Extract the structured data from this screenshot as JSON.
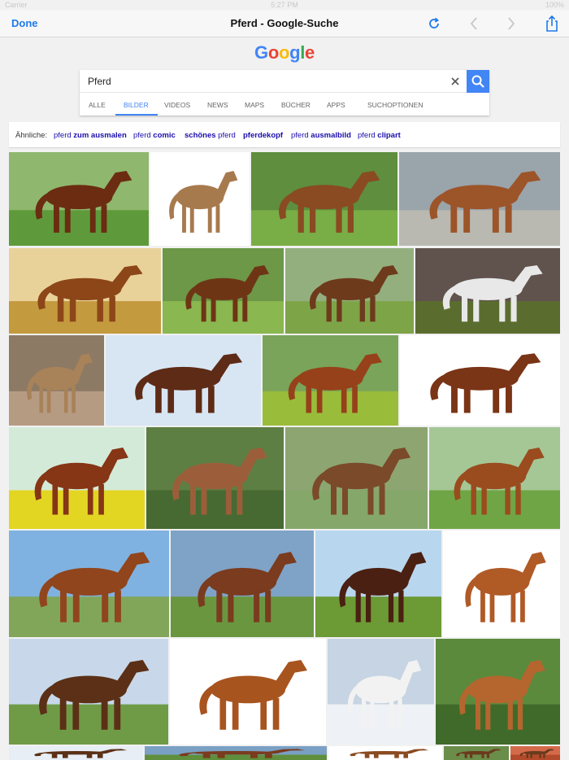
{
  "status_bar": {
    "carrier": "Carrier",
    "time": "5:27 PM",
    "battery": "100%"
  },
  "navbar": {
    "done_label": "Done",
    "title": "Pferd - Google-Suche",
    "icons": [
      "reload-icon",
      "back-arrow-icon",
      "forward-arrow-icon",
      "share-icon"
    ]
  },
  "logo": {
    "text": "Google",
    "colors": [
      "#4285f4",
      "#ea4335",
      "#fbbc05",
      "#4285f4",
      "#34a853",
      "#ea4335"
    ]
  },
  "search": {
    "query": "Pferd",
    "clear_icon": "clear-icon",
    "button_icon": "search-icon"
  },
  "tabs": [
    {
      "label": "ALLE",
      "active": false
    },
    {
      "label": "BILDER",
      "active": true
    },
    {
      "label": "VIDEOS",
      "active": false
    },
    {
      "label": "NEWS",
      "active": false
    },
    {
      "label": "MAPS",
      "active": false
    },
    {
      "label": "BÜCHER",
      "active": false
    },
    {
      "label": "APPS",
      "active": false
    },
    {
      "label": "SUCHOPTIONEN",
      "active": false
    }
  ],
  "related": {
    "label": "Ähnliche:",
    "chips": [
      {
        "prefix": "pferd",
        "suffix": "zum ausmalen",
        "bold_part": "suffix"
      },
      {
        "prefix": "pferd",
        "suffix": "comic",
        "bold_part": "suffix"
      },
      {
        "prefix": "schönes",
        "suffix": "pferd",
        "bold_part": "prefix"
      },
      {
        "prefix": "pferdekopf",
        "suffix": "",
        "bold_part": "prefix"
      },
      {
        "prefix": "pferd",
        "suffix": "ausmalbild",
        "bold_part": "suffix"
      },
      {
        "prefix": "pferd",
        "suffix": "clipart",
        "bold_part": "suffix"
      }
    ]
  },
  "images": [
    {
      "subject": "bay-horse-standing",
      "sky": "#8fb76d",
      "ground": "#5e9a3b",
      "horse": "#6b2c12"
    },
    {
      "subject": "palomino-pony-white-bg",
      "sky": "#ffffff",
      "ground": "#ffffff",
      "horse": "#a77a4e"
    },
    {
      "subject": "mare-with-foal",
      "sky": "#5e8e3e",
      "ground": "#79ad45",
      "horse": "#8a4a22"
    },
    {
      "subject": "horse-galloping-clouds",
      "sky": "#9aa4ab",
      "ground": "#b9b9b2",
      "horse": "#9c5429"
    },
    {
      "subject": "horse-sunset-field",
      "sky": "#e9d29a",
      "ground": "#c49a3f",
      "horse": "#8c4618"
    },
    {
      "subject": "bay-horse-trotting",
      "sky": "#6c9847",
      "ground": "#8bb750",
      "horse": "#6e3515"
    },
    {
      "subject": "brown-horse-meadow",
      "sky": "#93af7e",
      "ground": "#7ea448",
      "horse": "#6e3a1c"
    },
    {
      "subject": "white-horse-storm",
      "sky": "#60524c",
      "ground": "#5b6d2e",
      "horse": "#e8e8e8"
    },
    {
      "subject": "przewalski-horse",
      "sky": "#8d7a65",
      "ground": "#b69b83",
      "horse": "#a88258"
    },
    {
      "subject": "laughing-horse-head",
      "sky": "#d8e6f3",
      "ground": "#d8e6f3",
      "horse": "#5e2b16"
    },
    {
      "subject": "chestnut-horse-flowers",
      "sky": "#79a45a",
      "ground": "#9abc3b",
      "horse": "#96411a"
    },
    {
      "subject": "horse-running-white-bg",
      "sky": "#ffffff",
      "ground": "#ffffff",
      "horse": "#7a3416"
    },
    {
      "subject": "chestnut-horse-rapeseed",
      "sky": "#d4ead8",
      "ground": "#e3d623",
      "horse": "#863515"
    },
    {
      "subject": "blaze-face-horse",
      "sky": "#5e7f43",
      "ground": "#476a32",
      "horse": "#9c5e3a"
    },
    {
      "subject": "pinto-horse",
      "sky": "#8ca571",
      "ground": "#86a76a",
      "horse": "#7a4a2a"
    },
    {
      "subject": "chunky-chestnut-horse",
      "sky": "#a5c796",
      "ground": "#6fa544",
      "horse": "#9a4c1f"
    },
    {
      "subject": "bay-horse-sky",
      "sky": "#7fb2e0",
      "ground": "#81a65a",
      "horse": "#91451c"
    },
    {
      "subject": "horse-grazing",
      "sky": "#7fa3c7",
      "ground": "#6a963f",
      "horse": "#7a3b1e"
    },
    {
      "subject": "horses-rearing",
      "sky": "#b8d7ef",
      "ground": "#6c9a34",
      "horse": "#4a2012"
    },
    {
      "subject": "chestnut-horse-white-bg",
      "sky": "#ffffff",
      "ground": "#ffffff",
      "horse": "#b05a26"
    },
    {
      "subject": "bay-horse-fence",
      "sky": "#c8d8ea",
      "ground": "#6f9b47",
      "horse": "#5b3016"
    },
    {
      "subject": "horse-leaping-white-bg",
      "sky": "#ffffff",
      "ground": "#ffffff",
      "horse": "#a7541f"
    },
    {
      "subject": "white-horse-snow",
      "sky": "#c6d4e3",
      "ground": "#eef2f6",
      "horse": "#f2f2f2"
    },
    {
      "subject": "haflinger-head",
      "sky": "#5c8a3c",
      "ground": "#3f6a2a",
      "horse": "#b4662e"
    },
    {
      "subject": "partial-row-1",
      "sky": "#e7eef5",
      "ground": "#e7eef5",
      "horse": "#5b3016"
    },
    {
      "subject": "partial-row-2",
      "sky": "#7aa0c4",
      "ground": "#5f8f3c",
      "horse": "#7a3b1e"
    },
    {
      "subject": "partial-row-3",
      "sky": "#ffffff",
      "ground": "#ffffff",
      "horse": "#8b4a20"
    },
    {
      "subject": "partial-row-4",
      "sky": "#6a8d4a",
      "ground": "#6a8d4a",
      "horse": "#6a3a1c"
    },
    {
      "subject": "partial-row-5",
      "sky": "#d46a4a",
      "ground": "#b44a2c",
      "horse": "#6a3a1c"
    }
  ]
}
